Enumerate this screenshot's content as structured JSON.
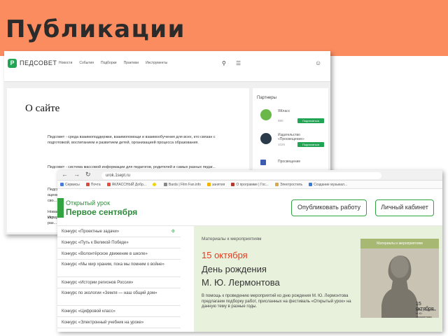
{
  "slide": {
    "title": "Публикации"
  },
  "pedsovet": {
    "brand": "ПЕДСОВЕТ",
    "menu": [
      "Новости",
      "События",
      "Подборки",
      "Практики",
      "Инструменты"
    ],
    "heading": "О сайте",
    "paragraphs": [
      "Педсовет - среда взаимоподдержки, взаимопомощи и взаимообучения для всех, кто связан с подготовкой, воспитанием и развитием детей, организацией процесса образования.",
      "Педсовет - система массовой информации для педагогов, родителей и самых разных педаг...",
      "Педсовет - ...",
      "оценку сво...",
      "Новая кар...",
      "История раз..."
    ],
    "sidebar": {
      "heading": "Партнеры",
      "items": [
        {
          "name": "ЯКласс",
          "count": "980",
          "button": "Подписаться"
        },
        {
          "name": "Издательство «Просвещение»",
          "count": "1025",
          "button": "Подписаться"
        },
        {
          "name": "Просвещение",
          "count": "",
          "button": ""
        }
      ]
    }
  },
  "browser": {
    "address": "urok.1sept.ru",
    "bookmarks": [
      "Сервисы",
      "Почта",
      "ЯКЛАССНЫЙ Добр...",
      "",
      "Bards | Film Fan.info",
      "занятия",
      "О программе | Гос...",
      "Электростиль",
      "Создание музыкал..."
    ]
  },
  "urok": {
    "logo_line1": "Открытый урок",
    "logo_line2": "Первое сентября",
    "publish_button": "Опубликовать работу",
    "cabinet_button": "Личный кабинет",
    "list": [
      "Конкурс «Проектные задачи»",
      "Конкурс «Путь к Великой Победе»",
      "Конкурс «Волонтёрское движение в школе»",
      "Конкурс «Мы мир храним, пока мы помним о войне»",
      "Конкурс «Истории регионов России»",
      "Конкурс по экологии «Земля — наш общий дом»",
      "Конкурс «Цифровой класс»",
      "Конкурс «Электронный учебник на уроке»"
    ],
    "banner": {
      "top": "Материалы к мероприятиям",
      "date": "15 октября",
      "title1": "День рождения",
      "title2": "М. Ю. Лермонтова",
      "description": "В помощь к проведению мероприятий ко дню рождения М. Ю. Лермонтова предлагаем подборку работ, присланных на фестиваль «Открытый урок» на данную тему в разные годы.",
      "image_header": "Материалы к мероприятиям",
      "image_date": "15 октября",
      "image_caption": "День рождения М.Ю. Лермонтова"
    }
  }
}
